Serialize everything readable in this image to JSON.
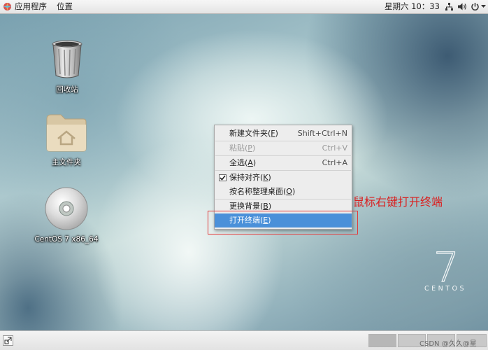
{
  "top_panel": {
    "applications": "应用程序",
    "places": "位置",
    "clock": "星期六 10：33",
    "icons": [
      "apps-icon",
      "network-icon",
      "volume-icon",
      "power-icon",
      "chevron-down-icon"
    ]
  },
  "desktop": {
    "icons": [
      {
        "label": "回收站",
        "icon": "trash-icon"
      },
      {
        "label": "主文件夹",
        "icon": "home-folder-icon"
      },
      {
        "label": "CentOS 7 x86_64",
        "icon": "cdrom-icon"
      }
    ],
    "logo": {
      "numeral": "7",
      "text": "CENTOS"
    }
  },
  "context_menu": {
    "items": [
      {
        "label": "新建文件夹(",
        "mnemonic": "F",
        "label_end": ")",
        "shortcut": "Shift+Ctrl+N",
        "enabled": true
      },
      {
        "label": "粘贴(",
        "mnemonic": "P",
        "label_end": ")",
        "shortcut": "Ctrl+V",
        "enabled": false
      },
      {
        "label": "全选(",
        "mnemonic": "A",
        "label_end": ")",
        "shortcut": "Ctrl+A",
        "enabled": true
      },
      {
        "label": "保持对齐(",
        "mnemonic": "K",
        "label_end": ")",
        "checked": true,
        "enabled": true
      },
      {
        "label": "按名称整理桌面(",
        "mnemonic": "O",
        "label_end": ")",
        "enabled": true
      },
      {
        "label": "更换背景(",
        "mnemonic": "B",
        "label_end": ")",
        "enabled": true
      },
      {
        "label": "打开终端(",
        "mnemonic": "E",
        "label_end": ")",
        "enabled": true,
        "highlighted": true
      }
    ]
  },
  "annotation": {
    "text": "鼠标右键打开终端",
    "color": "#d92121"
  },
  "bottom_panel": {
    "watermark": "CSDN @久久@星",
    "workspaces": 4
  },
  "colors": {
    "highlight": "#4a90d9",
    "annotation": "#e23a3a"
  }
}
